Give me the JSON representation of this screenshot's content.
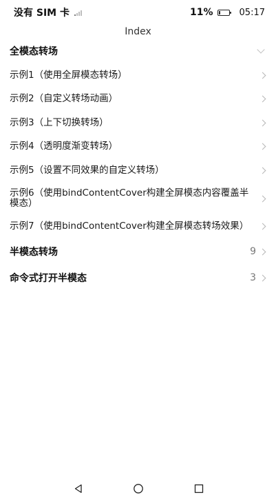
{
  "status_bar": {
    "carrier": "没有 SIM 卡",
    "battery_percent": "11%",
    "battery_level": 0.11,
    "time": "05:17"
  },
  "title": "Index",
  "sections": [
    {
      "label": "全模态转场",
      "expanded": true,
      "items": [
        {
          "label": "示例1（使用全屏模态转场）"
        },
        {
          "label": "示例2（自定义转场动画）"
        },
        {
          "label": "示例3（上下切换转场）"
        },
        {
          "label": "示例4（透明度渐变转场）"
        },
        {
          "label": "示例5（设置不同效果的自定义转场）"
        },
        {
          "label": "示例6（使用bindContentCover构建全屏模态内容覆盖半模态）"
        },
        {
          "label": "示例7（使用bindContentCover构建全屏模态转场效果）"
        }
      ]
    },
    {
      "label": "半模态转场",
      "count": "9"
    },
    {
      "label": "命令式打开半模态",
      "count": "3"
    }
  ],
  "nav": {
    "back_icon": "triangle-back-icon",
    "home_icon": "circle-home-icon",
    "recent_icon": "square-recent-icon"
  }
}
